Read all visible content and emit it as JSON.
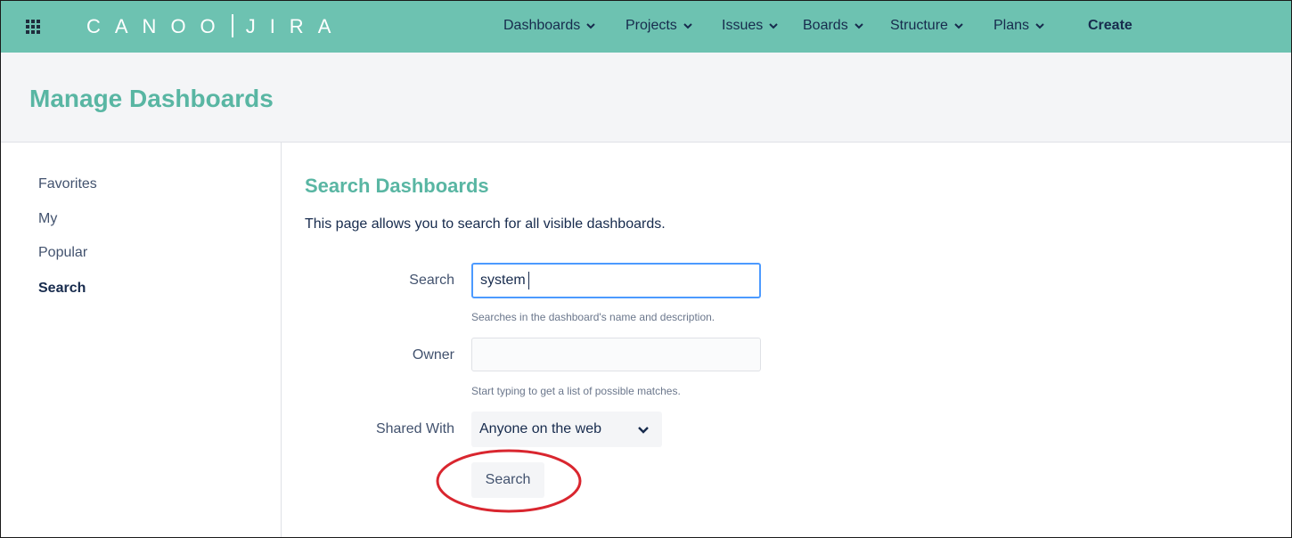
{
  "app": {
    "logo_left": "CANOO",
    "logo_right": "JIRA"
  },
  "nav": {
    "items": [
      {
        "label": "Dashboards"
      },
      {
        "label": "Projects"
      },
      {
        "label": "Issues"
      },
      {
        "label": "Boards"
      },
      {
        "label": "Structure"
      },
      {
        "label": "Plans"
      }
    ],
    "create_label": "Create"
  },
  "page": {
    "title": "Manage Dashboards"
  },
  "sidebar": {
    "items": [
      {
        "label": "Favorites"
      },
      {
        "label": "My"
      },
      {
        "label": "Popular"
      },
      {
        "label": "Search",
        "active": true
      }
    ]
  },
  "main": {
    "title": "Search Dashboards",
    "intro": "This page allows you to search for all visible dashboards.",
    "form": {
      "search_label": "Search",
      "search_value": "system",
      "search_help": "Searches in the dashboard's name and description.",
      "owner_label": "Owner",
      "owner_value": "",
      "owner_help": "Start typing to get a list of possible matches.",
      "shared_label": "Shared With",
      "shared_value": "Anyone on the web",
      "submit_label": "Search"
    }
  },
  "icons": {
    "app_switcher": "grid-icon",
    "dropdown": "chevron-down-icon",
    "annotation": "red-circle-annotation"
  },
  "colors": {
    "topbar": "#6dc2b1",
    "accent": "#59b6a3",
    "focus": "#4c9aff",
    "annotation": "#d9262f"
  }
}
